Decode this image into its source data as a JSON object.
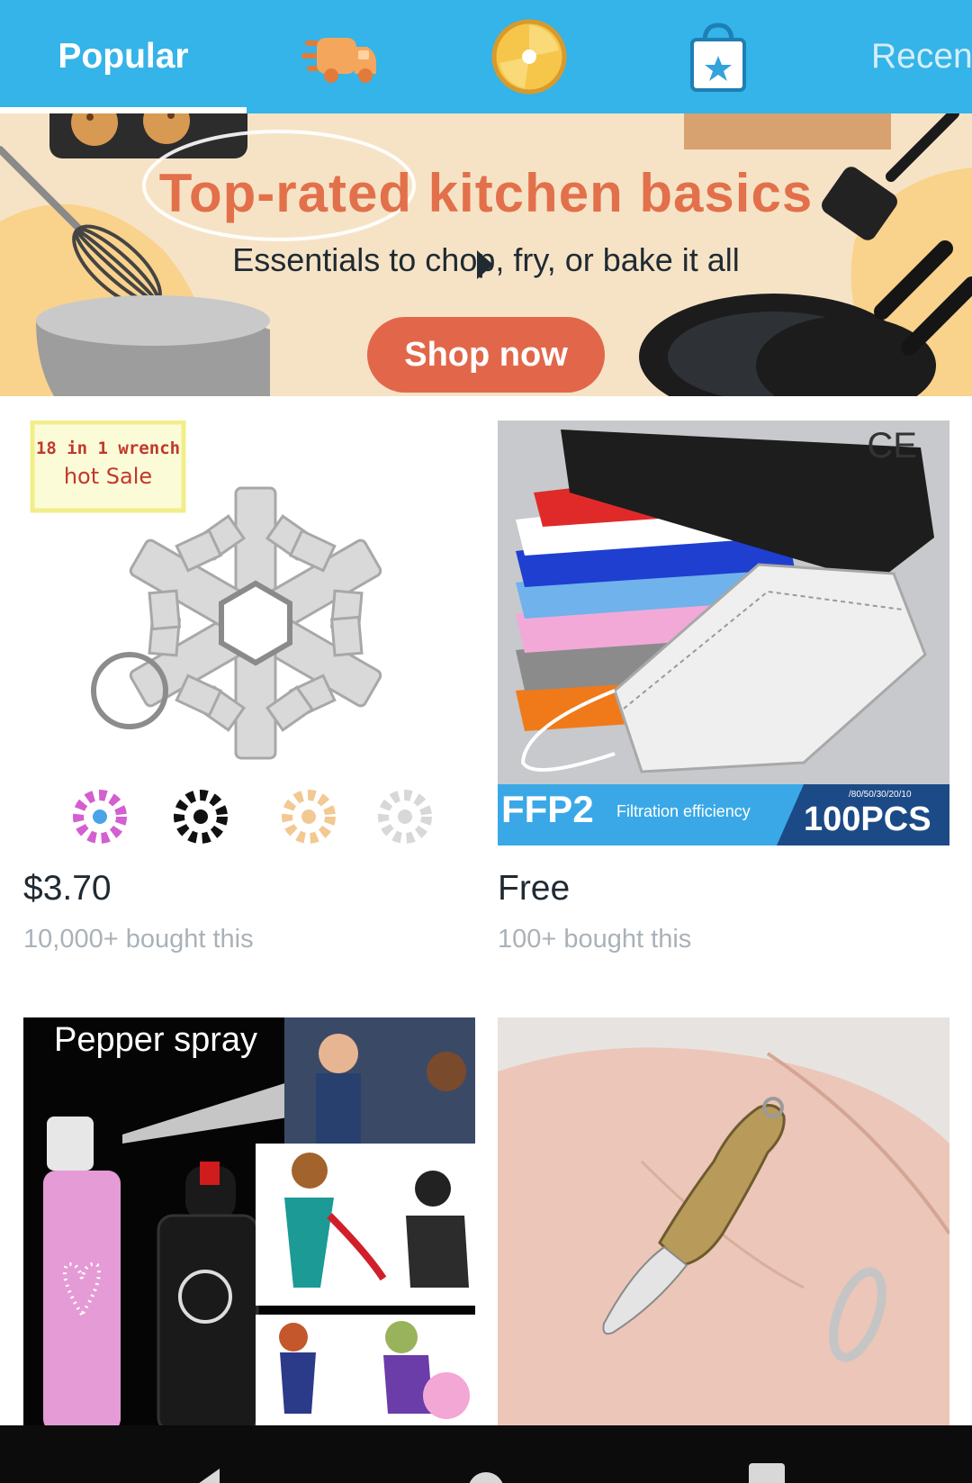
{
  "tabs": {
    "popular_label": "Popular",
    "recent_label": "Recen",
    "icons": [
      "delivery-truck-icon",
      "daily-spin-wheel-icon",
      "shopping-bag-star-icon"
    ],
    "accent_color": "#34b4e8"
  },
  "banner": {
    "title": "Top-rated kitchen basics",
    "subtitle": "Essentials to chop, fry, or bake it all",
    "button_label": "Shop now",
    "title_color": "#e2704a",
    "button_color": "#e2674a"
  },
  "products": [
    {
      "price": "$3.70",
      "bought": "10,000+ bought this",
      "image": {
        "badge_line1": "18 in 1 wrench",
        "badge_line2": "hot Sale"
      }
    },
    {
      "price": "Free",
      "bought": "100+ bought this",
      "image": {
        "ce_mark": "CE",
        "label_ffp2": "FFP2",
        "label_filtration": "Filtration efficiency",
        "label_pcs": "100PCS",
        "label_counts": "/80/50/30/20/10"
      }
    },
    {
      "image": {
        "caption": "Pepper spray"
      }
    },
    {
      "image": {}
    }
  ]
}
